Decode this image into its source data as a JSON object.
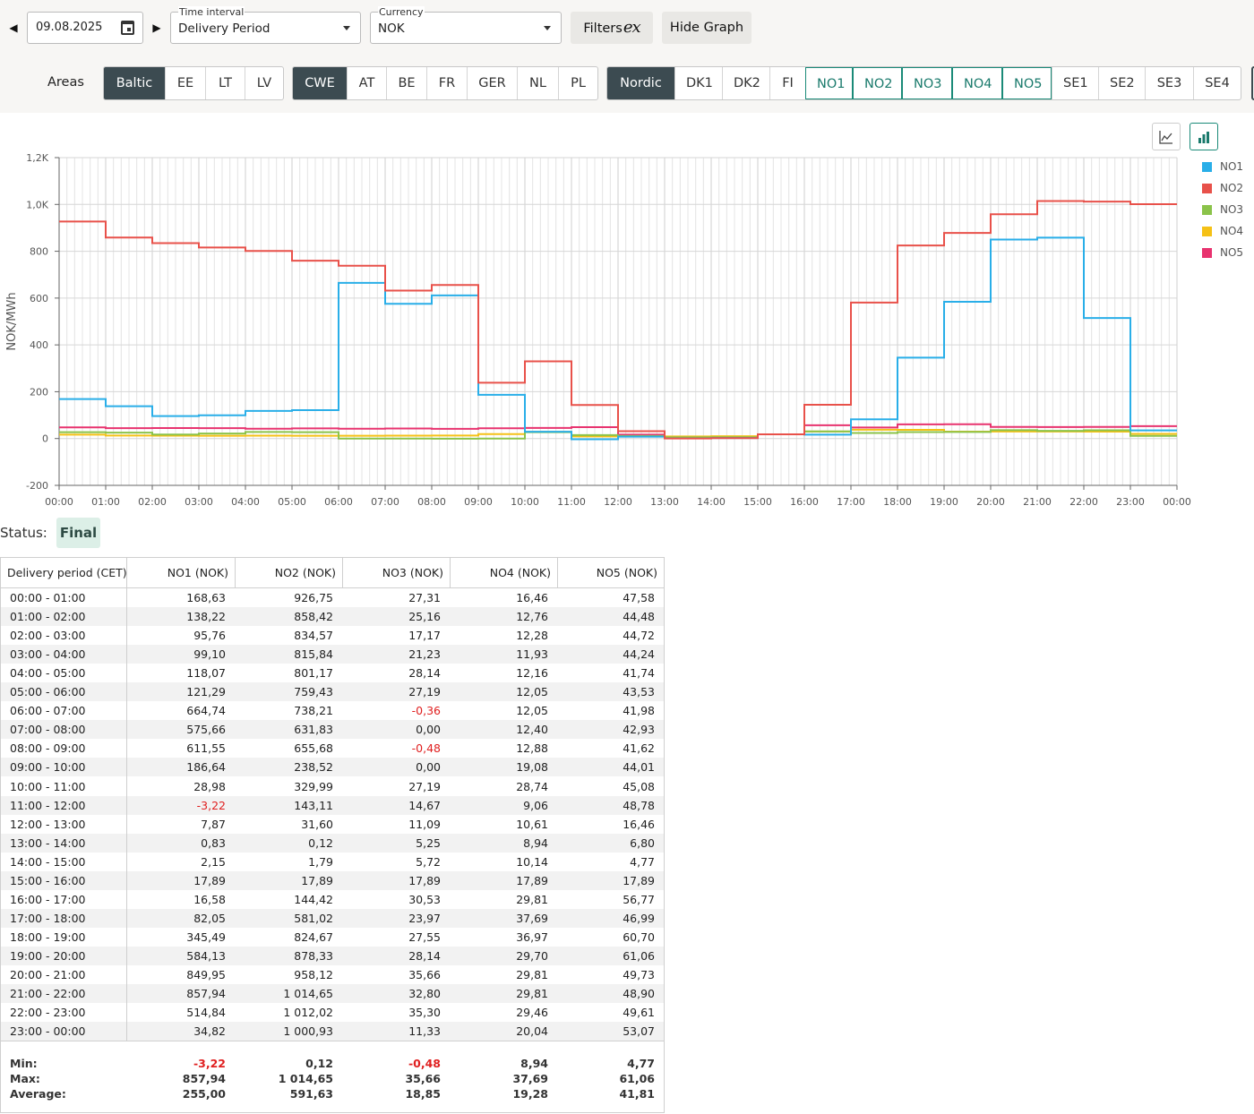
{
  "toolbar": {
    "date": "09.08.2025",
    "time_interval": {
      "label": "Time interval",
      "value": "Delivery Period"
    },
    "currency": {
      "label": "Currency",
      "value": "NOK"
    },
    "filters_label": "Filters",
    "filters_icon_glyph": "ex",
    "hide_graph_label": "Hide Graph",
    "areas_label": "Areas"
  },
  "area_groups": [
    {
      "items": [
        {
          "label": "Baltic",
          "state": "dark"
        },
        {
          "label": "EE"
        },
        {
          "label": "LT"
        },
        {
          "label": "LV"
        }
      ]
    },
    {
      "items": [
        {
          "label": "CWE",
          "state": "dark"
        },
        {
          "label": "AT"
        },
        {
          "label": "BE"
        },
        {
          "label": "FR"
        },
        {
          "label": "GER"
        },
        {
          "label": "NL"
        },
        {
          "label": "PL"
        }
      ]
    },
    {
      "items": [
        {
          "label": "Nordic",
          "state": "dark"
        },
        {
          "label": "DK1"
        },
        {
          "label": "DK2"
        },
        {
          "label": "FI"
        },
        {
          "label": "NO1",
          "state": "teal"
        },
        {
          "label": "NO2",
          "state": "teal"
        },
        {
          "label": "NO3",
          "state": "teal"
        },
        {
          "label": "NO4",
          "state": "teal"
        },
        {
          "label": "NO5",
          "state": "teal"
        },
        {
          "label": "SE1"
        },
        {
          "label": "SE2"
        },
        {
          "label": "SE3"
        },
        {
          "label": "SE4"
        }
      ]
    }
  ],
  "chart_data": {
    "type": "line",
    "step": true,
    "ylabel": "NOK/MWh",
    "ylim": [
      -200,
      1200
    ],
    "yticks": [
      -200,
      0,
      200,
      400,
      600,
      800,
      1000,
      1200
    ],
    "ytick_labels": [
      "-200",
      "0",
      "200",
      "400",
      "600",
      "800",
      "1,0K",
      "1,2K"
    ],
    "xtick_labels": [
      "00:00",
      "01:00",
      "02:00",
      "03:00",
      "04:00",
      "05:00",
      "06:00",
      "07:00",
      "08:00",
      "09:00",
      "10:00",
      "11:00",
      "12:00",
      "13:00",
      "14:00",
      "15:00",
      "16:00",
      "17:00",
      "18:00",
      "19:00",
      "20:00",
      "21:00",
      "22:00",
      "23:00",
      "00:00"
    ],
    "grid": true,
    "legend": "right",
    "series": [
      {
        "name": "NO1",
        "color": "#29aee8",
        "values": [
          168.63,
          138.22,
          95.76,
          99.1,
          118.07,
          121.29,
          664.74,
          575.66,
          611.55,
          186.64,
          28.98,
          -3.22,
          7.87,
          0.83,
          2.15,
          17.89,
          16.58,
          82.05,
          345.49,
          584.13,
          849.95,
          857.94,
          514.84,
          34.82
        ]
      },
      {
        "name": "NO2",
        "color": "#e8514a",
        "values": [
          926.75,
          858.42,
          834.57,
          815.84,
          801.17,
          759.43,
          738.21,
          631.83,
          655.68,
          238.52,
          329.99,
          143.11,
          31.6,
          0.12,
          1.79,
          17.89,
          144.42,
          581.02,
          824.67,
          878.33,
          958.12,
          1014.65,
          1012.02,
          1000.93
        ]
      },
      {
        "name": "NO3",
        "color": "#8bc34a",
        "values": [
          27.31,
          25.16,
          17.17,
          21.23,
          28.14,
          27.19,
          -0.36,
          0.0,
          -0.48,
          0.0,
          27.19,
          14.67,
          11.09,
          5.25,
          5.72,
          17.89,
          30.53,
          23.97,
          27.55,
          28.14,
          35.66,
          32.8,
          35.3,
          11.33
        ]
      },
      {
        "name": "NO4",
        "color": "#f5c116",
        "values": [
          16.46,
          12.76,
          12.28,
          11.93,
          12.16,
          12.05,
          12.05,
          12.4,
          12.88,
          19.08,
          28.74,
          9.06,
          10.61,
          8.94,
          10.14,
          17.89,
          29.81,
          37.69,
          36.97,
          29.7,
          29.81,
          29.81,
          29.46,
          20.04
        ]
      },
      {
        "name": "NO5",
        "color": "#e8336f",
        "values": [
          47.58,
          44.48,
          44.72,
          44.24,
          41.74,
          43.53,
          41.98,
          42.93,
          41.62,
          44.01,
          45.08,
          48.78,
          16.46,
          6.8,
          4.77,
          17.89,
          56.77,
          46.99,
          60.7,
          61.06,
          49.73,
          48.9,
          49.61,
          53.07
        ]
      }
    ]
  },
  "status": {
    "label": "Status:",
    "value": "Final"
  },
  "table": {
    "headers": [
      "Delivery period (CET)",
      "NO1 (NOK)",
      "NO2 (NOK)",
      "NO3 (NOK)",
      "NO4 (NOK)",
      "NO5 (NOK)"
    ],
    "rows": [
      [
        "00:00 - 01:00",
        "168,63",
        "926,75",
        "27,31",
        "16,46",
        "47,58"
      ],
      [
        "01:00 - 02:00",
        "138,22",
        "858,42",
        "25,16",
        "12,76",
        "44,48"
      ],
      [
        "02:00 - 03:00",
        "95,76",
        "834,57",
        "17,17",
        "12,28",
        "44,72"
      ],
      [
        "03:00 - 04:00",
        "99,10",
        "815,84",
        "21,23",
        "11,93",
        "44,24"
      ],
      [
        "04:00 - 05:00",
        "118,07",
        "801,17",
        "28,14",
        "12,16",
        "41,74"
      ],
      [
        "05:00 - 06:00",
        "121,29",
        "759,43",
        "27,19",
        "12,05",
        "43,53"
      ],
      [
        "06:00 - 07:00",
        "664,74",
        "738,21",
        "-0,36",
        "12,05",
        "41,98"
      ],
      [
        "07:00 - 08:00",
        "575,66",
        "631,83",
        "0,00",
        "12,40",
        "42,93"
      ],
      [
        "08:00 - 09:00",
        "611,55",
        "655,68",
        "-0,48",
        "12,88",
        "41,62"
      ],
      [
        "09:00 - 10:00",
        "186,64",
        "238,52",
        "0,00",
        "19,08",
        "44,01"
      ],
      [
        "10:00 - 11:00",
        "28,98",
        "329,99",
        "27,19",
        "28,74",
        "45,08"
      ],
      [
        "11:00 - 12:00",
        "-3,22",
        "143,11",
        "14,67",
        "9,06",
        "48,78"
      ],
      [
        "12:00 - 13:00",
        "7,87",
        "31,60",
        "11,09",
        "10,61",
        "16,46"
      ],
      [
        "13:00 - 14:00",
        "0,83",
        "0,12",
        "5,25",
        "8,94",
        "6,80"
      ],
      [
        "14:00 - 15:00",
        "2,15",
        "1,79",
        "5,72",
        "10,14",
        "4,77"
      ],
      [
        "15:00 - 16:00",
        "17,89",
        "17,89",
        "17,89",
        "17,89",
        "17,89"
      ],
      [
        "16:00 - 17:00",
        "16,58",
        "144,42",
        "30,53",
        "29,81",
        "56,77"
      ],
      [
        "17:00 - 18:00",
        "82,05",
        "581,02",
        "23,97",
        "37,69",
        "46,99"
      ],
      [
        "18:00 - 19:00",
        "345,49",
        "824,67",
        "27,55",
        "36,97",
        "60,70"
      ],
      [
        "19:00 - 20:00",
        "584,13",
        "878,33",
        "28,14",
        "29,70",
        "61,06"
      ],
      [
        "20:00 - 21:00",
        "849,95",
        "958,12",
        "35,66",
        "29,81",
        "49,73"
      ],
      [
        "21:00 - 22:00",
        "857,94",
        "1 014,65",
        "32,80",
        "29,81",
        "48,90"
      ],
      [
        "22:00 - 23:00",
        "514,84",
        "1 012,02",
        "35,30",
        "29,46",
        "49,61"
      ],
      [
        "23:00 - 00:00",
        "34,82",
        "1 000,93",
        "11,33",
        "20,04",
        "53,07"
      ]
    ],
    "footer": [
      [
        "Min:",
        "-3,22",
        "0,12",
        "-0,48",
        "8,94",
        "4,77"
      ],
      [
        "Max:",
        "857,94",
        "1 014,65",
        "35,66",
        "37,69",
        "61,06"
      ],
      [
        "Average:",
        "255,00",
        "591,63",
        "18,85",
        "19,28",
        "41,81"
      ]
    ]
  }
}
